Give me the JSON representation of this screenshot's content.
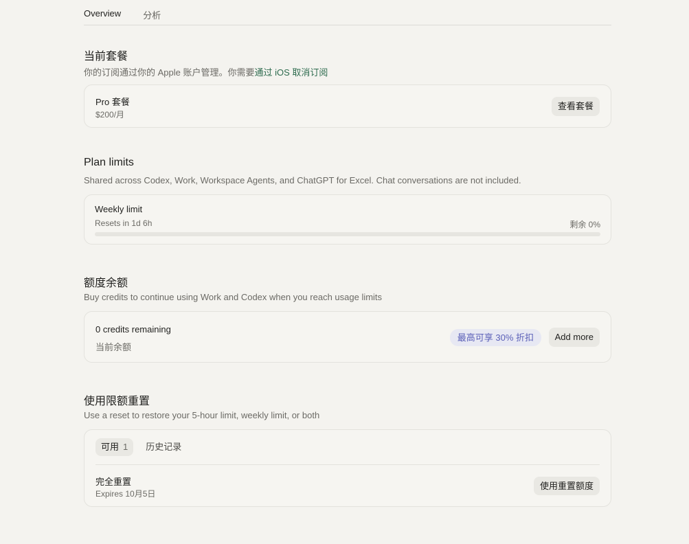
{
  "tabs": [
    {
      "label": "Overview",
      "active": true
    },
    {
      "label": "分析",
      "active": false
    }
  ],
  "current_plan": {
    "title": "当前套餐",
    "subtitle": "你的订阅通过你的 Apple 账户管理。你需要",
    "subtitle_link": "通过 iOS 取消订阅",
    "plan_name": "Pro 套餐",
    "price": "$200/月",
    "view_button": "查看套餐"
  },
  "plan_limits": {
    "title": "Plan limits",
    "subtitle": "Shared across Codex, Work, Workspace Agents, and ChatGPT for Excel. Chat conversations are not included.",
    "weekly_label": "Weekly limit",
    "resets": "Resets in 1d 6h",
    "remaining": "剩余 0%",
    "remaining_fraction": 0
  },
  "credits": {
    "title": "额度余额",
    "subtitle": "Buy credits to continue using Work and Codex when you reach usage limits",
    "remaining": "0 credits remaining",
    "balance_label": "当前余额",
    "discount_badge": "最高可享 30% 折扣",
    "add_button": "Add more"
  },
  "resets": {
    "title": "使用限额重置",
    "subtitle": "Use a reset to restore your 5-hour limit, weekly limit, or both",
    "tab_available": "可用",
    "tab_available_count": "1",
    "tab_history": "历史记录",
    "item_name": "完全重置",
    "item_expires": "Expires 10月5日",
    "use_button": "使用重置额度"
  },
  "colors": {
    "background": "#f4f3ef",
    "link": "#2d6b4e",
    "badge_text": "#5b60b8",
    "badge_bg": "#e7e8f3"
  }
}
